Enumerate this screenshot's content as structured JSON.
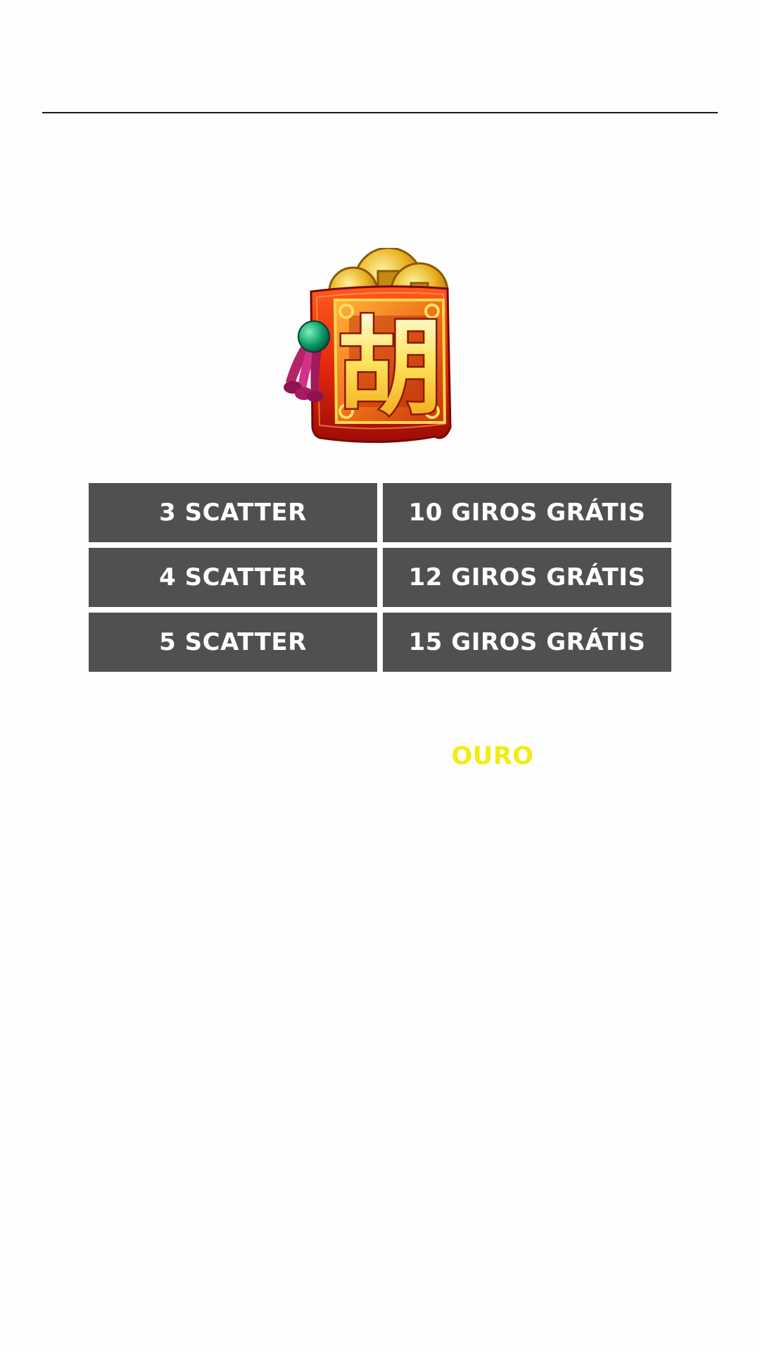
{
  "symbol": {
    "icon": "red-envelope-hu-scatter-icon",
    "glyph": "胡"
  },
  "pay_table": {
    "rows": [
      {
        "symbols": "3 SCATTER",
        "reward": "10 GIROS GRÁTIS"
      },
      {
        "symbols": "4 SCATTER",
        "reward": "12 GIROS GRÁTIS"
      },
      {
        "symbols": "5 SCATTER",
        "reward": "15 GIROS GRÁTIS"
      }
    ]
  },
  "highlight": {
    "word": "OURO",
    "color": "#f2ec12"
  },
  "colors": {
    "cell_background": "#505050",
    "cell_text": "#ffffff",
    "divider": "#1a1a1a"
  }
}
